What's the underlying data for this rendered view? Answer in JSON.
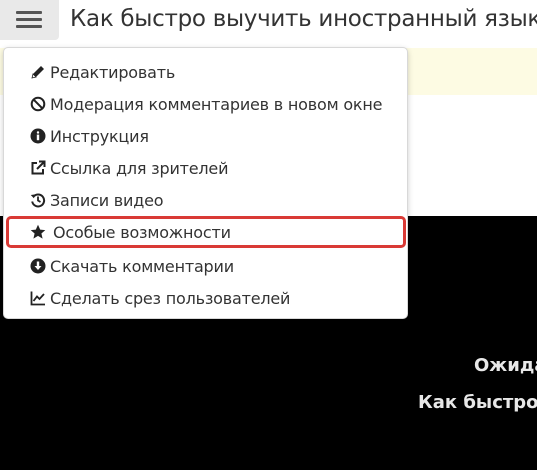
{
  "header": {
    "title": "Как быстро выучить иностранный язык",
    "menu_icon": "hamburger-icon"
  },
  "dropdown": {
    "items": [
      {
        "label": "Редактировать",
        "icon": "pencil-icon"
      },
      {
        "label": "Модерация комментариев в новом окне",
        "icon": "ban-icon"
      },
      {
        "label": "Инструкция",
        "icon": "info-circle-icon"
      },
      {
        "label": "Ссылка для зрителей",
        "icon": "external-link-icon"
      },
      {
        "label": "Записи видео",
        "icon": "history-icon"
      },
      {
        "label": "Особые возможности",
        "icon": "star-icon",
        "highlighted": true
      },
      {
        "label": "Скачать комментарии",
        "icon": "download-circle-icon"
      },
      {
        "label": "Сделать срез пользователей",
        "icon": "line-chart-icon"
      }
    ]
  },
  "video": {
    "line1": "Ожида",
    "line2": "Как быстро"
  },
  "colors": {
    "highlight_border": "#d93a35",
    "notice_bg": "#fdfbe3",
    "menu_button_bg": "#e9e9e9"
  }
}
